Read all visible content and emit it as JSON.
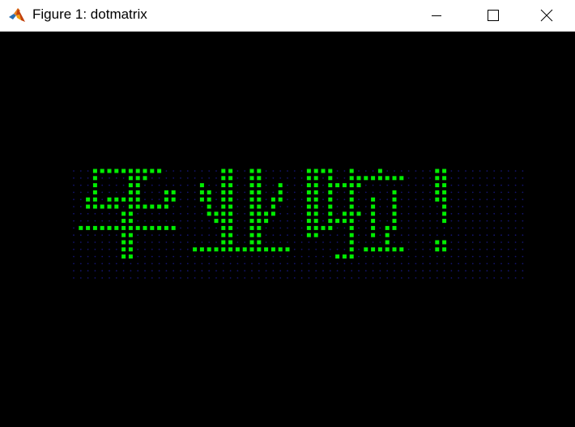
{
  "window": {
    "title": "Figure 1: dotmatrix",
    "icon": "matlab-logo-icon",
    "controls": [
      "minimize-icon",
      "maximize-icon",
      "close-icon"
    ]
  },
  "display": {
    "type": "led-dot-matrix",
    "text": "毕业啦！",
    "background_color": "#000000",
    "off_dot_color": "#14146e",
    "on_dot_color": "#00ee00",
    "rows": 16,
    "cols": 64
  }
}
